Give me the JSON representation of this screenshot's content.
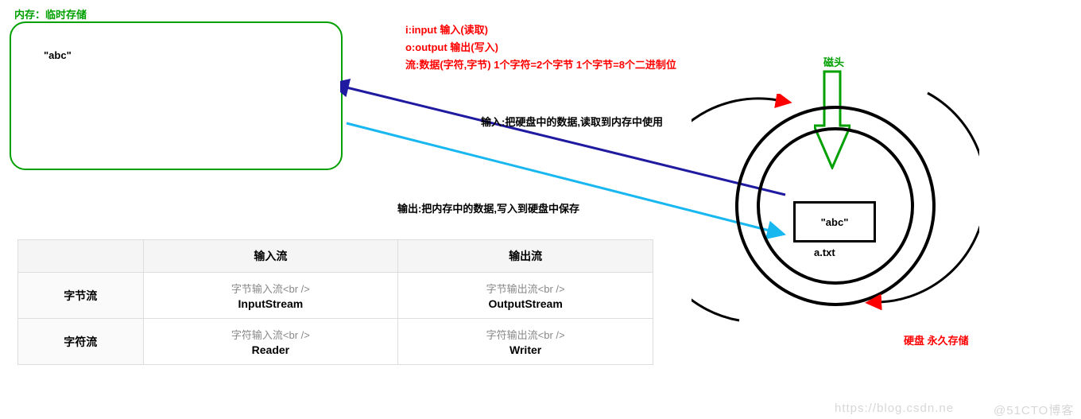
{
  "memory": {
    "label": "内存：临时存储",
    "value": "\"abc\""
  },
  "notes": {
    "l1": "i:input 输入(读取)",
    "l2": "o:output 输出(写入)",
    "l3": "流:数据(字符,字节) 1个字符=2个字节 1个字节=8个二进制位"
  },
  "flows": {
    "input": "输入:把硬盘中的数据,读取到内存中使用",
    "output": "输出:把内存中的数据,写入到硬盘中保存"
  },
  "disk": {
    "head": "磁头",
    "file_value": "\"abc\"",
    "file_name": "a.txt",
    "label": "硬盘 永久存储"
  },
  "table": {
    "h_in": "输入流",
    "h_out": "输出流",
    "row_byte": "字节流",
    "row_char": "字符流",
    "byte_in_sub": "字节输入流<br />",
    "byte_in": "InputStream",
    "byte_out_sub": "字节输出流<br />",
    "byte_out": "OutputStream",
    "char_in_sub": "字符输入流<br />",
    "char_in": "Reader",
    "char_out_sub": "字符输出流<br />",
    "char_out": "Writer"
  },
  "watermark": {
    "w1": "https://blog.csdn.ne",
    "w2": "@51CTO博客"
  }
}
